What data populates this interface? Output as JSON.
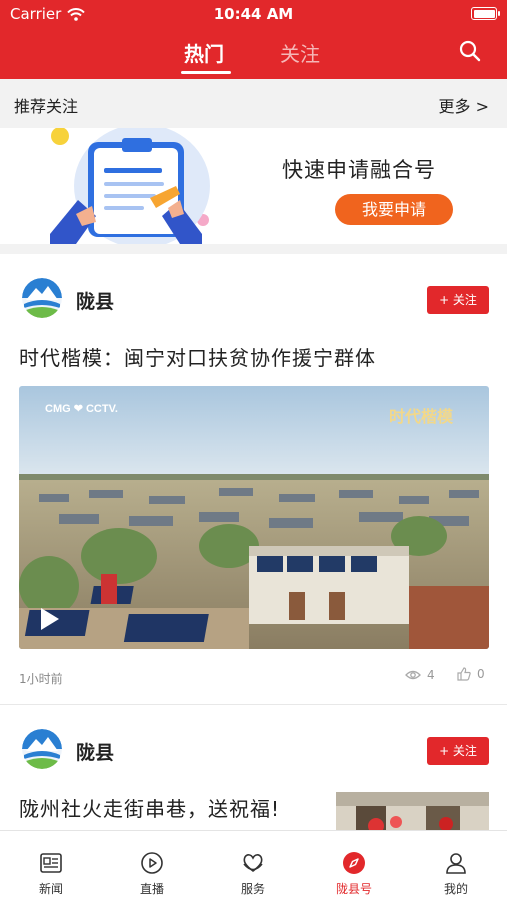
{
  "status_bar": {
    "carrier": "Carrier",
    "time": "10:44 AM"
  },
  "tabs": [
    {
      "label": "热门",
      "active": true
    },
    {
      "label": "关注",
      "active": false
    }
  ],
  "recommend": {
    "title": "推荐关注",
    "more": "更多 >"
  },
  "banner": {
    "title": "快速申请融合号",
    "button": "我要申请"
  },
  "feed": [
    {
      "author": "陇县",
      "follow_label": "+ 关注",
      "title": "时代楷模：闽宁对口扶贫协作援宁群体",
      "image_watermark_left": "CMG ❤ CCTV.",
      "image_watermark_right": "时代楷模",
      "time": "1小时前",
      "views": "4",
      "likes": "0"
    },
    {
      "author": "陇县",
      "follow_label": "+ 关注",
      "title": "陇州社火走街串巷，送祝福!"
    }
  ],
  "tabbar": [
    {
      "label": "新闻",
      "icon": "news-icon",
      "active": false
    },
    {
      "label": "直播",
      "icon": "play-icon",
      "active": false
    },
    {
      "label": "服务",
      "icon": "service-heart-icon",
      "active": false
    },
    {
      "label": "陇县号",
      "icon": "compass-icon",
      "active": true
    },
    {
      "label": "我的",
      "icon": "user-icon",
      "active": false
    }
  ],
  "colors": {
    "brand_red": "#e2282b",
    "apply_orange": "#f0641e"
  }
}
